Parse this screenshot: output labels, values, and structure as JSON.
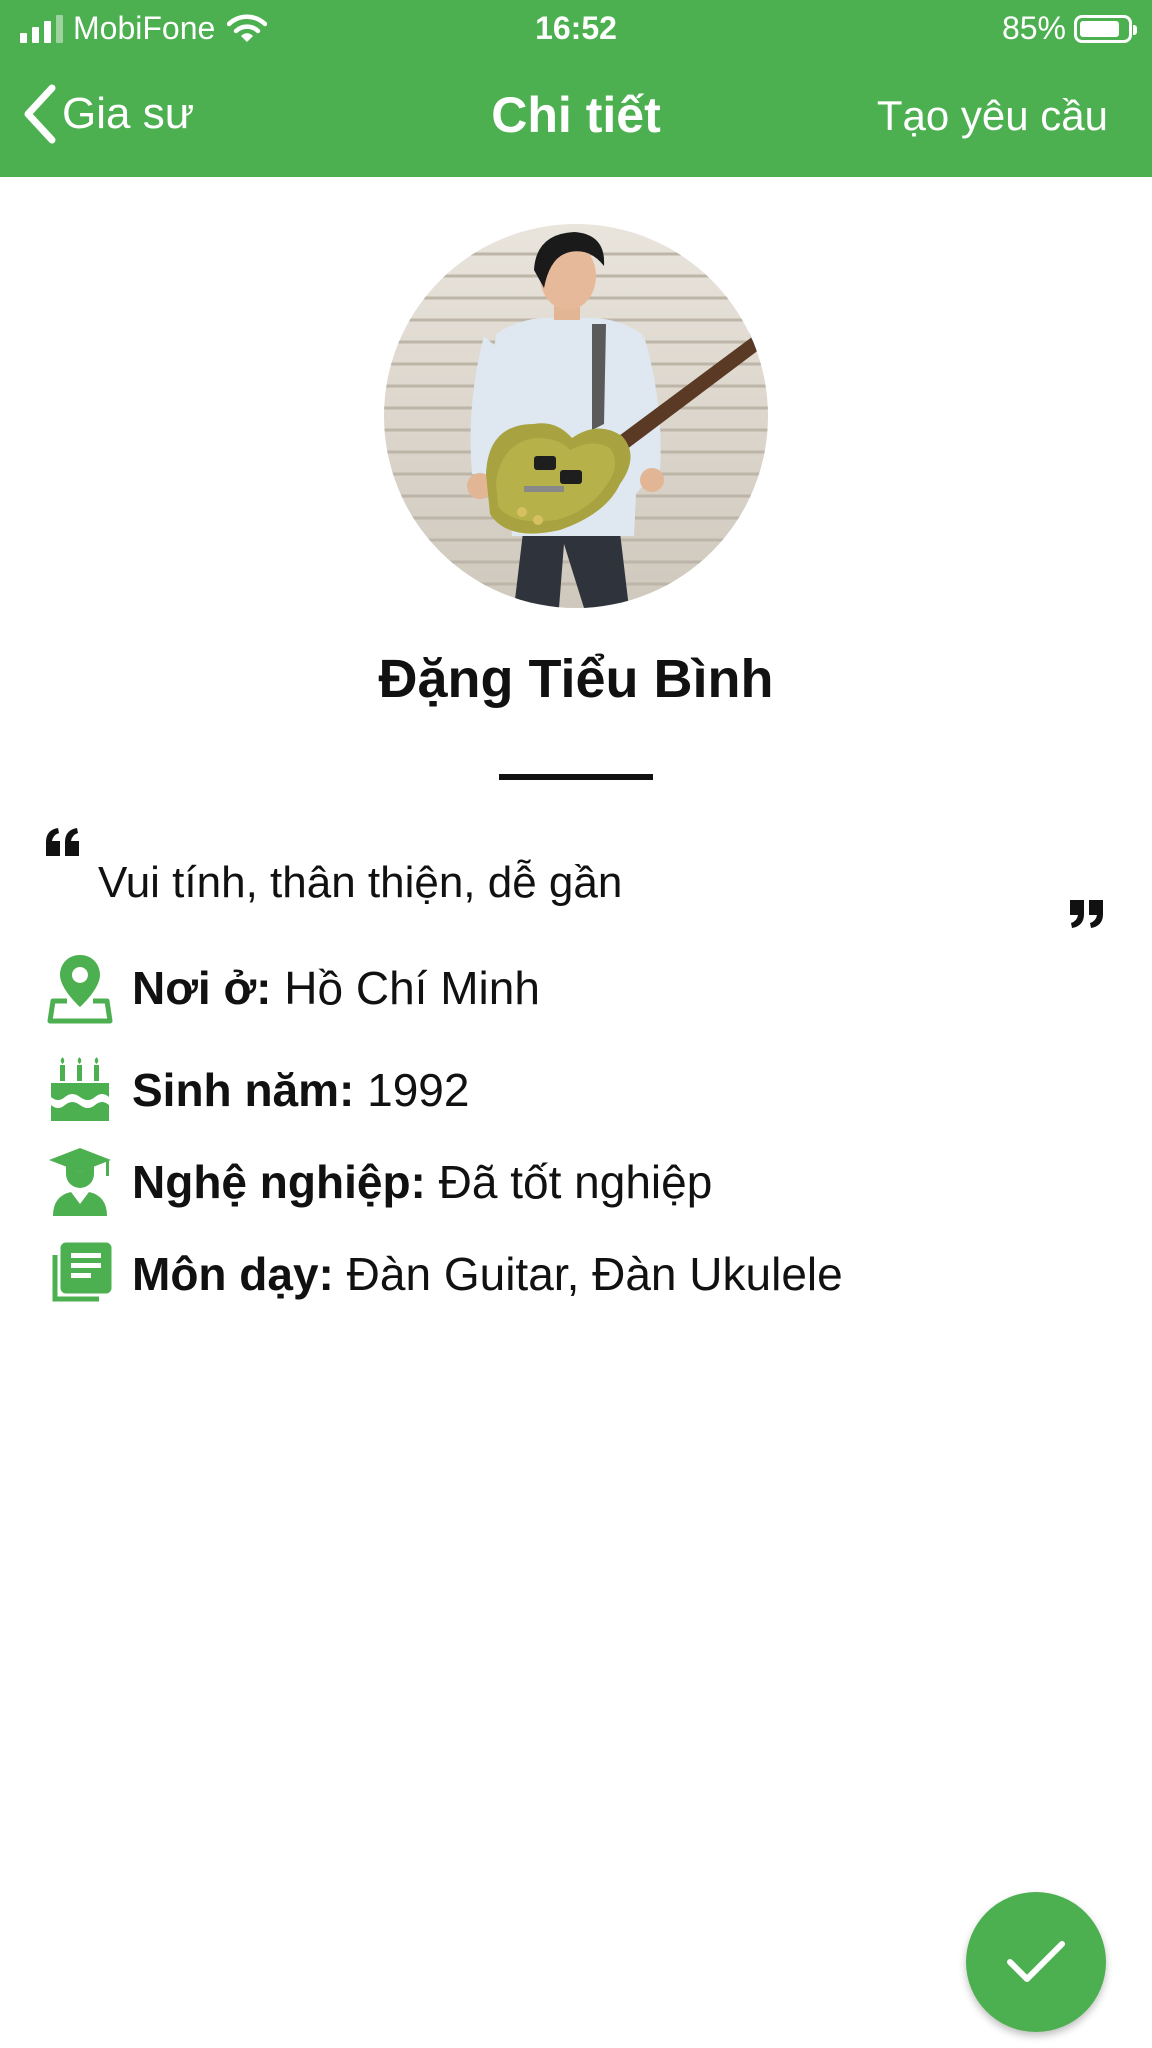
{
  "status_bar": {
    "carrier": "MobiFone",
    "time": "16:52",
    "battery": "85%",
    "battery_level": 0.85
  },
  "nav": {
    "back_label": "Gia sư",
    "title": "Chi tiết",
    "action_label": "Tạo yêu cầu"
  },
  "profile": {
    "name": "Đặng Tiểu Bình",
    "bio": "Vui tính, thân thiện, dễ gần",
    "info": [
      {
        "icon": "location-pin-icon",
        "label": "Nơi ở:",
        "value": "Hồ Chí Minh"
      },
      {
        "icon": "birthday-cake-icon",
        "label": "Sinh năm:",
        "value": "1992"
      },
      {
        "icon": "graduate-icon",
        "label": "Nghệ nghiệp:",
        "value": "Đã tốt nghiệp"
      },
      {
        "icon": "subjects-icon",
        "label": "Môn dạy:",
        "value": "Đàn Guitar, Đàn Ukulele"
      }
    ]
  },
  "colors": {
    "primary": "#4CAF50",
    "text": "#111111",
    "background": "#ffffff"
  },
  "icons": {
    "back": "chevron-left-icon",
    "fab": "check-icon",
    "quote_open": "quote-open-icon",
    "quote_close": "quote-close-icon"
  }
}
